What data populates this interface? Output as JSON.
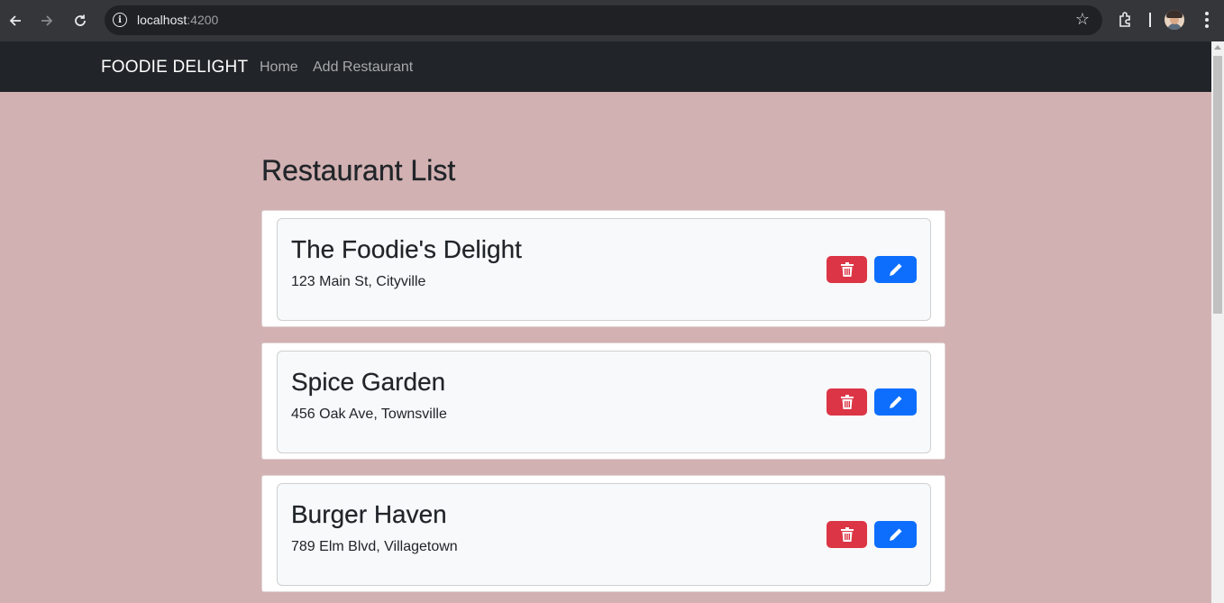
{
  "browser": {
    "url_host": "localhost",
    "url_port": ":4200"
  },
  "navbar": {
    "brand": "FOODIE DELIGHT",
    "links": [
      "Home",
      "Add Restaurant"
    ]
  },
  "page": {
    "title": "Restaurant List"
  },
  "restaurants": [
    {
      "name": "The Foodie's Delight",
      "address": "123 Main St, Cityville"
    },
    {
      "name": "Spice Garden",
      "address": "456 Oak Ave, Townsville"
    },
    {
      "name": "Burger Haven",
      "address": "789 Elm Blvd, Villagetown"
    }
  ],
  "icons": {
    "delete": "trash-icon",
    "edit": "pencil-icon"
  },
  "colors": {
    "background": "#d2b1b2",
    "navbar": "#212529",
    "delete": "#dc3545",
    "edit": "#0d6efd"
  }
}
